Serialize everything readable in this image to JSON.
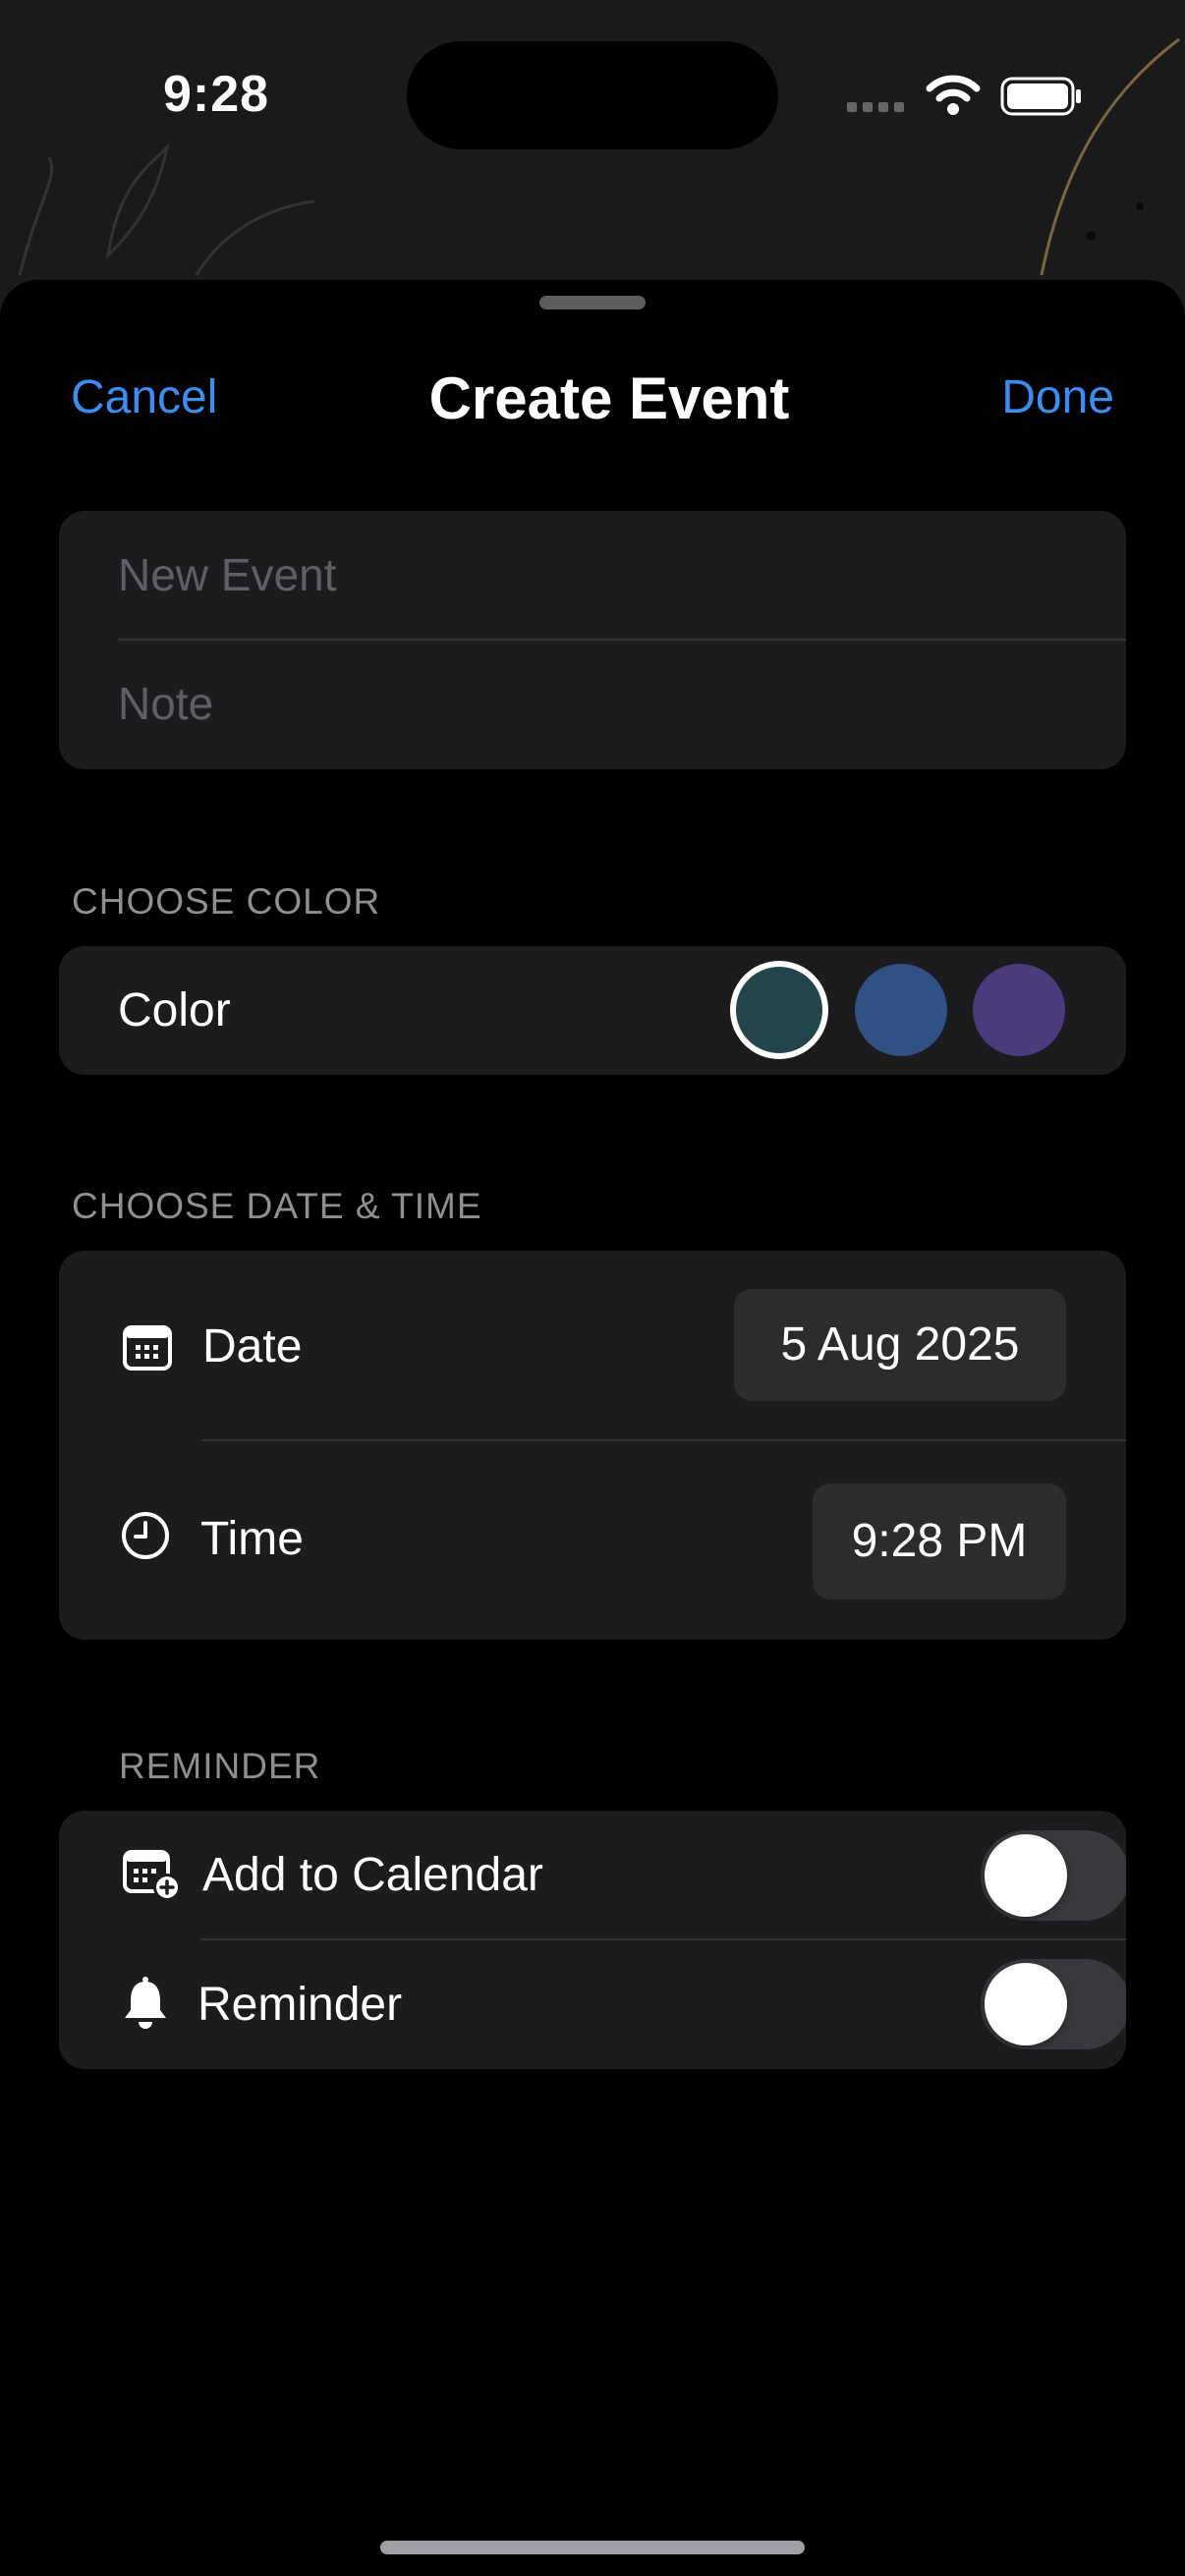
{
  "status_bar": {
    "time": "9:28"
  },
  "nav": {
    "cancel": "Cancel",
    "title": "Create Event",
    "done": "Done"
  },
  "details": {
    "title_placeholder": "New Event",
    "note_placeholder": "Note"
  },
  "color_section": {
    "header": "CHOOSE COLOR",
    "label": "Color",
    "swatches": [
      "#23434d",
      "#2f5184",
      "#4b3a7c"
    ],
    "selected_index": 0
  },
  "datetime_section": {
    "header": "CHOOSE DATE & TIME",
    "date_label": "Date",
    "date_value": "5 Aug 2025",
    "time_label": "Time",
    "time_value": "9:28 PM"
  },
  "reminder_section": {
    "header": "REMINDER",
    "add_to_calendar_label": "Add to Calendar",
    "add_to_calendar_on": false,
    "reminder_label": "Reminder",
    "reminder_on": false
  },
  "colors": {
    "accent": "#3a8ef0",
    "card": "#1c1c1e",
    "background": "#000000"
  }
}
